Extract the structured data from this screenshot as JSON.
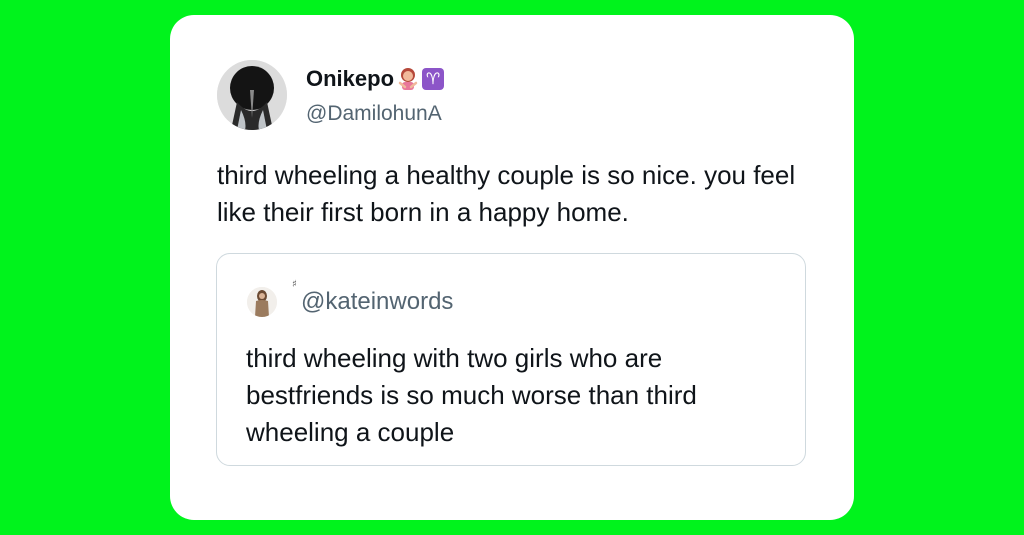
{
  "tweet": {
    "display_name": "Onikepo",
    "name_emojis": [
      "woman-gesturing-emoji",
      "aries-emoji"
    ],
    "aries_symbol": "♈",
    "handle": "@DamilohunA",
    "text": "third wheeling a healthy couple is so nice. you feel like their first born in a happy home."
  },
  "quoted_tweet": {
    "marker": "♯",
    "handle": "@kateinwords",
    "text": "third wheeling with two girls who are bestfriends is so much worse than third wheeling a couple"
  },
  "colors": {
    "background": "#00f31c",
    "card": "#ffffff",
    "primary_text": "#0f1419",
    "secondary_text": "#536471",
    "quote_border": "#cfd9de"
  }
}
